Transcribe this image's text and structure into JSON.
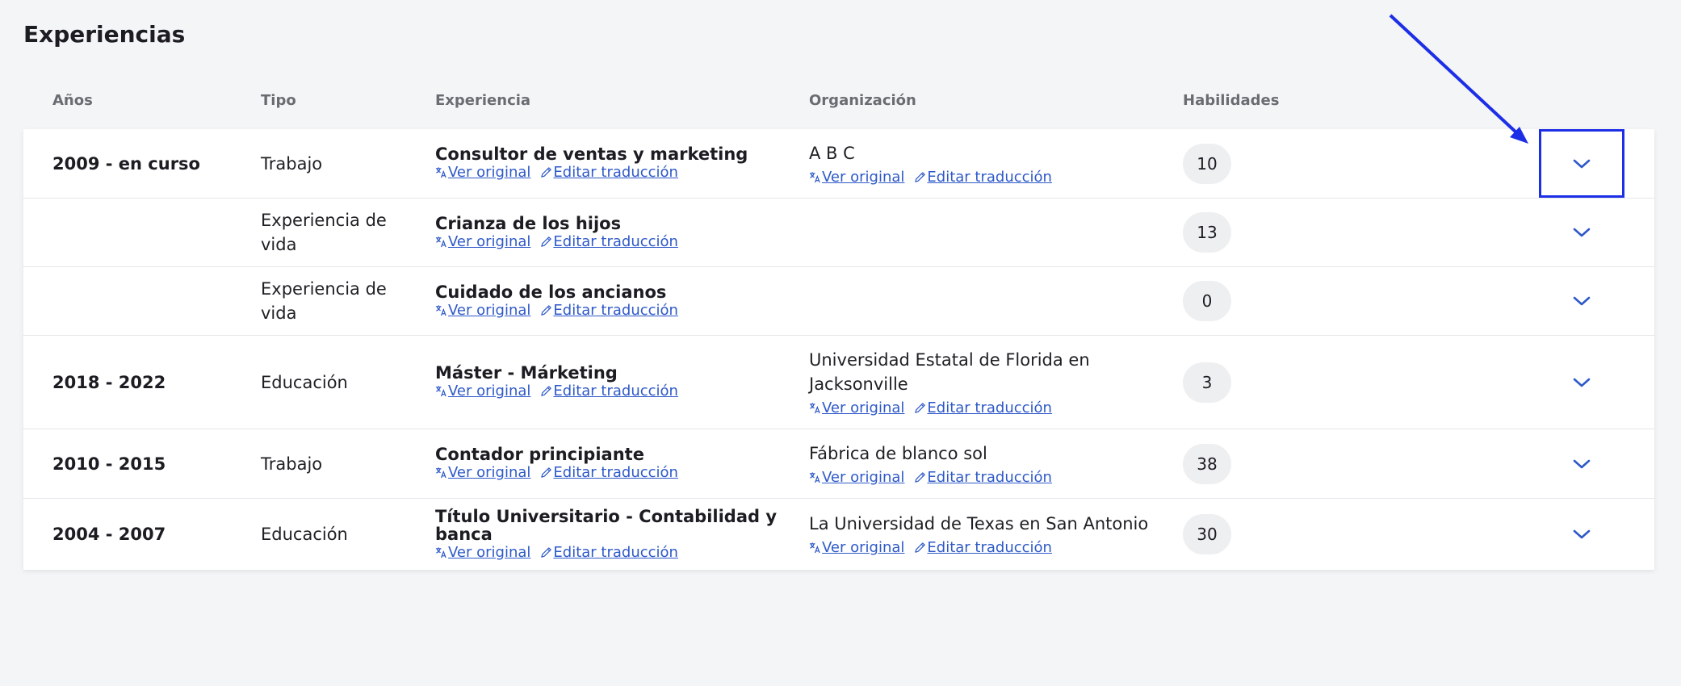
{
  "page": {
    "title": "Experiencias"
  },
  "table": {
    "headers": {
      "years": "Años",
      "type": "Tipo",
      "experience": "Experiencia",
      "organization": "Organización",
      "skills": "Habilidades"
    },
    "link_labels": {
      "view_original": "Ver original",
      "edit_translation": "Editar traducción"
    },
    "rows": [
      {
        "years": "2009 - en curso",
        "type": "Trabajo",
        "experience": "Consultor de ventas y marketing",
        "organization": "A B C",
        "skills": "10",
        "expanded_highlight": true
      },
      {
        "years": "",
        "type": "Experiencia de vida",
        "experience": "Crianza de los hijos",
        "organization": "",
        "skills": "13"
      },
      {
        "years": "",
        "type": "Experiencia de vida",
        "experience": "Cuidado de los ancianos",
        "organization": "",
        "skills": "0"
      },
      {
        "years": "2018 - 2022",
        "type": "Educación",
        "experience": "Máster - Márketing",
        "organization": "Universidad Estatal de Florida en Jacksonville",
        "skills": "3"
      },
      {
        "years": "2010 - 2015",
        "type": "Trabajo",
        "experience": "Contador principiante",
        "organization": "Fábrica de blanco sol",
        "skills": "38"
      },
      {
        "years": "2004 - 2007",
        "type": "Educación",
        "experience": "Título Universitario - Contabilidad y banca",
        "organization": "La Universidad de Texas en San Antonio",
        "skills": "30"
      }
    ]
  },
  "icons": {
    "translate": "translate-icon",
    "edit": "pencil-icon",
    "expand": "chevron-down-icon"
  },
  "colors": {
    "link": "#2e59c8",
    "chevron": "#2e59c8",
    "annotation": "#1d2fe6",
    "badge_bg": "#eeeff1",
    "page_bg": "#f4f5f7"
  }
}
